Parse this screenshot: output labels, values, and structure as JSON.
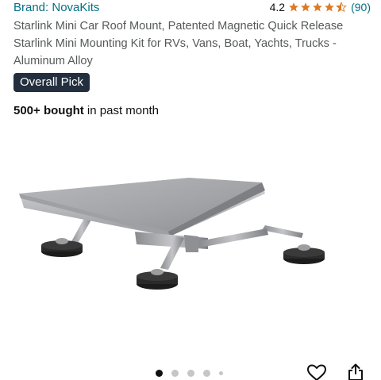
{
  "brand": {
    "label": "Brand: NovaKits"
  },
  "rating": {
    "value": "4.2",
    "stars": 4.2,
    "count": "(90)",
    "star_color": "#de7921"
  },
  "product": {
    "title": "Starlink Mini Car Roof Mount, Patented Magnetic Quick Release Starlink Mini Mounting Kit for RVs, Vans, Boat, Yachts, Trucks - Aluminum Alloy",
    "badge": "Overall Pick",
    "bought_count": "500+ bought",
    "bought_suffix": " in past month"
  },
  "carousel": {
    "total_dots": 5,
    "active_index": 0
  },
  "icons": {
    "wishlist": "heart-icon",
    "share": "share-icon"
  },
  "colors": {
    "link": "#007185",
    "badge_bg": "#232f3e",
    "text": "#0f1111"
  }
}
